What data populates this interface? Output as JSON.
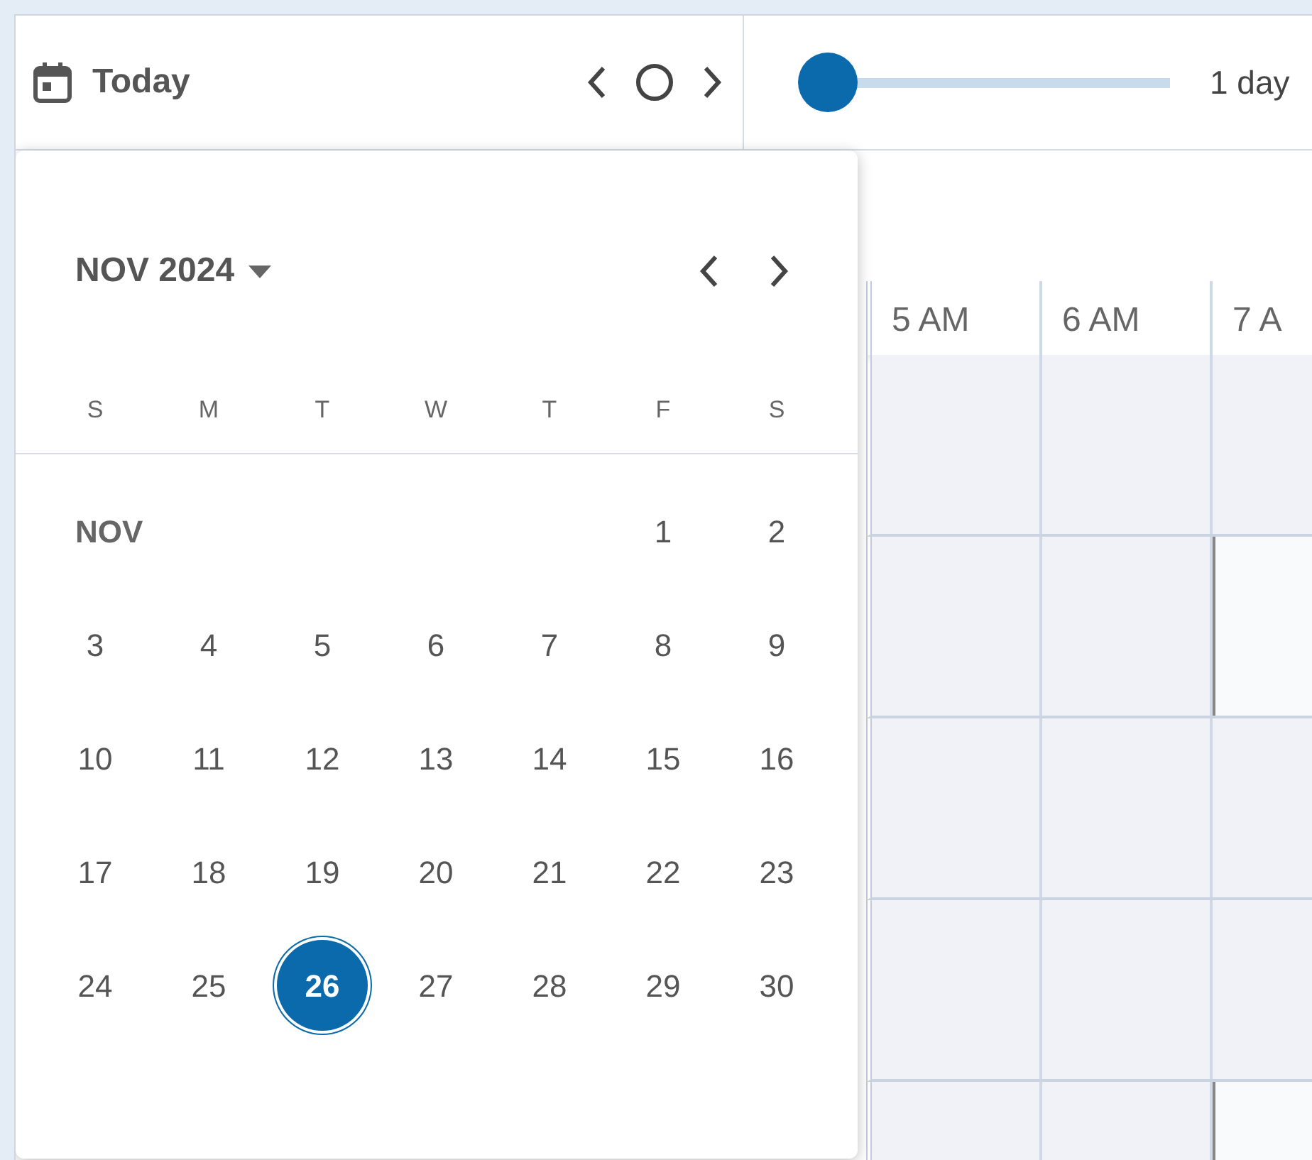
{
  "toolbar": {
    "today_label": "Today",
    "slider": {
      "level": 0,
      "reading": "1 day"
    }
  },
  "timeline": {
    "hours": [
      "5 AM",
      "6 AM",
      "7 A"
    ],
    "rows": [
      {
        "cells": [
          {
            "free": false
          },
          {
            "free": false
          },
          {
            "free": false
          }
        ]
      },
      {
        "cells": [
          {
            "free": false
          },
          {
            "free": false
          },
          {
            "free": true
          }
        ]
      },
      {
        "cells": [
          {
            "free": false
          },
          {
            "free": false
          },
          {
            "free": false
          }
        ]
      },
      {
        "cells": [
          {
            "free": false
          },
          {
            "free": false
          },
          {
            "free": false
          }
        ]
      },
      {
        "cells": [
          {
            "free": false
          },
          {
            "free": false
          },
          {
            "free": true
          }
        ]
      }
    ]
  },
  "date_picker": {
    "month_year": "NOV 2024",
    "weekdays": [
      "S",
      "M",
      "T",
      "W",
      "T",
      "F",
      "S"
    ],
    "month_label": "NOV",
    "weeks": [
      {
        "kind": "partial",
        "days": [
          {
            "day": "1",
            "selected": false
          },
          {
            "day": "2",
            "selected": false
          }
        ]
      },
      {
        "kind": "full",
        "days": [
          {
            "day": "3",
            "selected": false
          },
          {
            "day": "4",
            "selected": false
          },
          {
            "day": "5",
            "selected": false
          },
          {
            "day": "6",
            "selected": false
          },
          {
            "day": "7",
            "selected": false
          },
          {
            "day": "8",
            "selected": false
          },
          {
            "day": "9",
            "selected": false
          }
        ]
      },
      {
        "kind": "full",
        "days": [
          {
            "day": "10",
            "selected": false
          },
          {
            "day": "11",
            "selected": false
          },
          {
            "day": "12",
            "selected": false
          },
          {
            "day": "13",
            "selected": false
          },
          {
            "day": "14",
            "selected": false
          },
          {
            "day": "15",
            "selected": false
          },
          {
            "day": "16",
            "selected": false
          }
        ]
      },
      {
        "kind": "full",
        "days": [
          {
            "day": "17",
            "selected": false
          },
          {
            "day": "18",
            "selected": false
          },
          {
            "day": "19",
            "selected": false
          },
          {
            "day": "20",
            "selected": false
          },
          {
            "day": "21",
            "selected": false
          },
          {
            "day": "22",
            "selected": false
          },
          {
            "day": "23",
            "selected": false
          }
        ]
      },
      {
        "kind": "full",
        "days": [
          {
            "day": "24",
            "selected": false
          },
          {
            "day": "25",
            "selected": false
          },
          {
            "day": "26",
            "selected": true
          },
          {
            "day": "27",
            "selected": false
          },
          {
            "day": "28",
            "selected": false
          },
          {
            "day": "29",
            "selected": false
          },
          {
            "day": "30",
            "selected": false
          }
        ]
      }
    ]
  }
}
